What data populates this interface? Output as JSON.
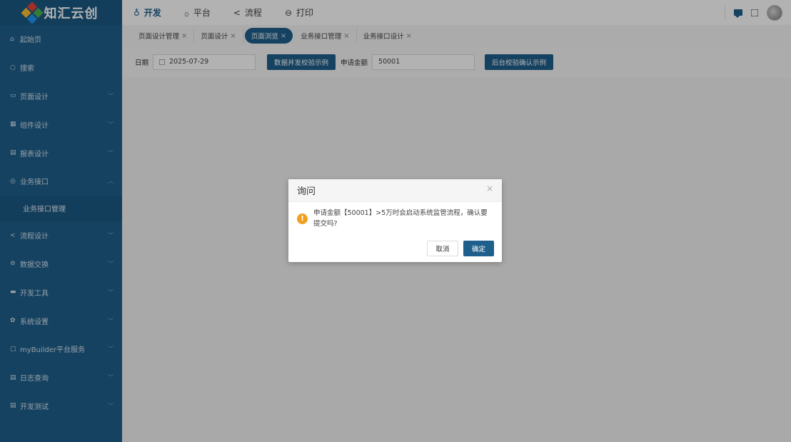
{
  "app": {
    "name": "知汇云创"
  },
  "sidebar": {
    "items": [
      {
        "label": "起始页",
        "icon": "home-icon",
        "glyph": "⌂",
        "chev": ""
      },
      {
        "label": "搜索",
        "icon": "search-icon",
        "glyph": "○",
        "chev": ""
      },
      {
        "label": "页面设计",
        "icon": "page-icon",
        "glyph": "▭",
        "chev": "﹀"
      },
      {
        "label": "组件设计",
        "icon": "grid-icon",
        "glyph": "▦",
        "chev": "﹀"
      },
      {
        "label": "报表设计",
        "icon": "report-icon",
        "glyph": "▤",
        "chev": "﹀"
      },
      {
        "label": "业务接口",
        "icon": "interface-icon",
        "glyph": "◎",
        "chev": "︿"
      },
      {
        "label": "流程设计",
        "icon": "share-icon",
        "glyph": "<",
        "chev": "﹀"
      },
      {
        "label": "数据交换",
        "icon": "database-icon",
        "glyph": "⊜",
        "chev": "﹀"
      },
      {
        "label": "开发工具",
        "icon": "toolbox-icon",
        "glyph": "▬",
        "chev": "﹀"
      },
      {
        "label": "系统设置",
        "icon": "gear-icon",
        "glyph": "✿",
        "chev": "﹀"
      },
      {
        "label": "myBuilder平台服务",
        "icon": "cup-icon",
        "glyph": "▢",
        "chev": "﹀"
      },
      {
        "label": "日志查询",
        "icon": "log-icon",
        "glyph": "▤",
        "chev": "﹀"
      },
      {
        "label": "开发测试",
        "icon": "test-icon",
        "glyph": "▤",
        "chev": "﹀"
      }
    ],
    "subitem": "业务接口管理"
  },
  "topnav": {
    "items": [
      {
        "label": "开发",
        "glyph": "♁"
      },
      {
        "label": "平台",
        "glyph": "۞"
      },
      {
        "label": "流程",
        "glyph": "<"
      },
      {
        "label": "打印",
        "glyph": "⊖"
      }
    ]
  },
  "tabs": [
    {
      "label": "页面设计管理"
    },
    {
      "label": "页面设计"
    },
    {
      "label": "页面浏览"
    },
    {
      "label": "业务接口管理"
    },
    {
      "label": "业务接口设计"
    }
  ],
  "form": {
    "date_label": "日期",
    "date_value": "2025-07-29",
    "btn_concurrent": "数据并发校验示例",
    "amount_label": "申请金额",
    "amount_value": "50001",
    "btn_backend": "后台校验确认示例"
  },
  "dialog": {
    "title": "询问",
    "close": "×",
    "icon_glyph": "!",
    "message": "申请金额【50001】>5万时会启动系统监管流程，确认要提交吗?",
    "cancel": "取消",
    "ok": "确定"
  },
  "colors": {
    "primary": "#1f5f8b",
    "warning": "#f0a020"
  }
}
